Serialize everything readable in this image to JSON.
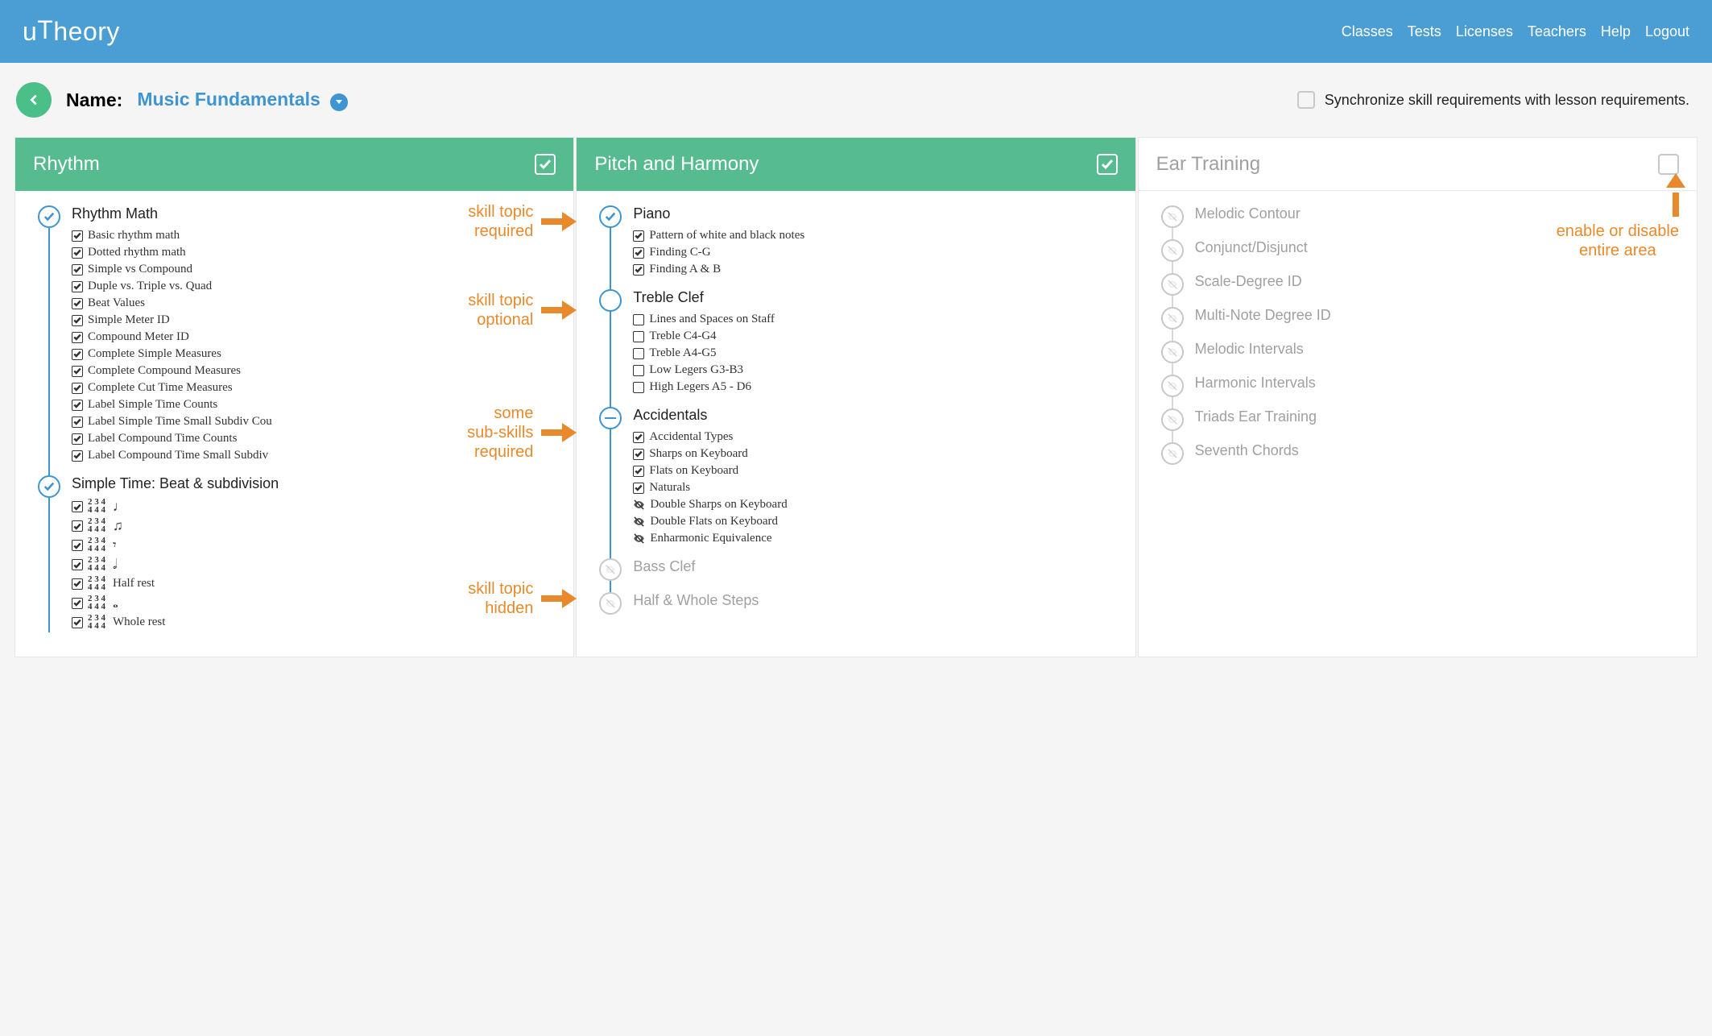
{
  "brand": "uTheory",
  "nav": {
    "classes": "Classes",
    "tests": "Tests",
    "licenses": "Licenses",
    "teachers": "Teachers",
    "help": "Help",
    "logout": "Logout"
  },
  "title": {
    "name_label": "Name:",
    "name_value": "Music Fundamentals"
  },
  "sync": {
    "label": "Synchronize skill requirements with lesson requirements."
  },
  "columns": {
    "rhythm": {
      "title": "Rhythm",
      "topics": [
        {
          "title": "Rhythm Math",
          "state": "required",
          "skills": [
            {
              "label": "Basic rhythm math",
              "checked": true
            },
            {
              "label": "Dotted rhythm math",
              "checked": true
            },
            {
              "label": "Simple vs Compound",
              "checked": true
            },
            {
              "label": "Duple vs. Triple vs. Quad",
              "checked": true
            },
            {
              "label": "Beat Values",
              "checked": true
            },
            {
              "label": "Simple Meter ID",
              "checked": true
            },
            {
              "label": "Compound Meter ID",
              "checked": true
            },
            {
              "label": "Complete Simple Measures",
              "checked": true
            },
            {
              "label": "Complete Compound Measures",
              "checked": true
            },
            {
              "label": "Complete Cut Time Measures",
              "checked": true
            },
            {
              "label": "Label Simple Time Counts",
              "checked": true
            },
            {
              "label": "Label Simple Time Small Subdiv Cou",
              "checked": true
            },
            {
              "label": "Label Compound Time Counts",
              "checked": true
            },
            {
              "label": "Label Compound Time Small Subdiv",
              "checked": true
            }
          ]
        },
        {
          "title": "Simple Time: Beat & subdivision",
          "state": "required",
          "skills": [
            {
              "label": "",
              "sig": true,
              "glyph": "♩",
              "checked": true
            },
            {
              "label": "",
              "sig": true,
              "glyph": "♫",
              "checked": true
            },
            {
              "label": "",
              "sig": true,
              "glyph": "𝄾",
              "checked": true
            },
            {
              "label": "",
              "sig": true,
              "glyph": "𝅗𝅥",
              "checked": true
            },
            {
              "label": "Half rest",
              "sig": true,
              "glyph": "",
              "checked": true
            },
            {
              "label": "",
              "sig": true,
              "glyph": "𝅝",
              "checked": true
            },
            {
              "label": "Whole rest",
              "sig": true,
              "glyph": "",
              "checked": true
            }
          ]
        }
      ]
    },
    "pitch": {
      "title": "Pitch and Harmony",
      "topics": [
        {
          "title": "Piano",
          "state": "required",
          "skills": [
            {
              "label": "Pattern of white and black notes",
              "checked": true
            },
            {
              "label": "Finding C-G",
              "checked": true
            },
            {
              "label": "Finding A & B",
              "checked": true
            }
          ]
        },
        {
          "title": "Treble Clef",
          "state": "optional",
          "skills": [
            {
              "label": "Lines and Spaces on Staff",
              "checked": false
            },
            {
              "label": "Treble C4-G4",
              "checked": false
            },
            {
              "label": "Treble A4-G5",
              "checked": false
            },
            {
              "label": "Low Legers G3-B3",
              "checked": false
            },
            {
              "label": "High Legers A5 - D6",
              "checked": false
            }
          ]
        },
        {
          "title": "Accidentals",
          "state": "partial",
          "skills": [
            {
              "label": "Accidental Types",
              "checked": true
            },
            {
              "label": "Sharps on Keyboard",
              "checked": true
            },
            {
              "label": "Flats on Keyboard",
              "checked": true
            },
            {
              "label": "Naturals",
              "checked": true
            },
            {
              "label": "Double Sharps on Keyboard",
              "hidden": true
            },
            {
              "label": "Double Flats on Keyboard",
              "hidden": true
            },
            {
              "label": "Enharmonic Equivalence",
              "hidden": true
            }
          ]
        },
        {
          "title": "Bass Clef",
          "state": "hidden",
          "skills": []
        },
        {
          "title": "Half & Whole Steps",
          "state": "hidden",
          "skills": []
        }
      ]
    },
    "ear": {
      "title": "Ear Training",
      "topics": [
        {
          "title": "Melodic Contour",
          "state": "hidden"
        },
        {
          "title": "Conjunct/Disjunct",
          "state": "hidden"
        },
        {
          "title": "Scale-Degree ID",
          "state": "hidden"
        },
        {
          "title": "Multi-Note Degree ID",
          "state": "hidden"
        },
        {
          "title": "Melodic Intervals",
          "state": "hidden"
        },
        {
          "title": "Harmonic Intervals",
          "state": "hidden"
        },
        {
          "title": "Triads Ear Training",
          "state": "hidden"
        },
        {
          "title": "Seventh Chords",
          "state": "hidden"
        }
      ]
    }
  },
  "annotations": {
    "required": "skill topic\nrequired",
    "optional": "skill topic\noptional",
    "partial": "some\nsub-skills\nrequired",
    "hidden": "skill topic\nhidden",
    "enable_disable": "enable or disable\nentire area"
  }
}
